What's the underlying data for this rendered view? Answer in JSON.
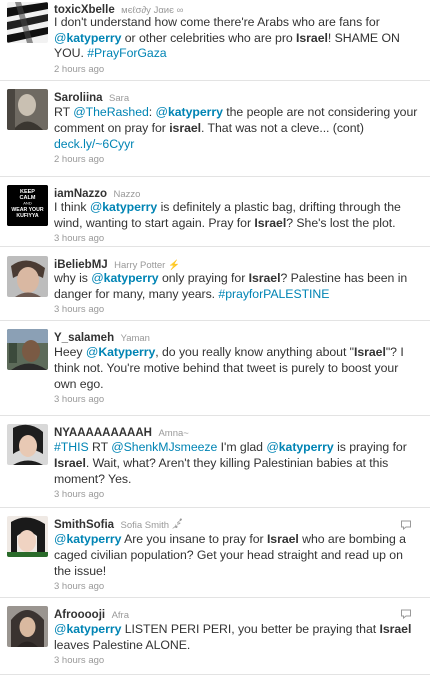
{
  "tweets": [
    {
      "screen_name": "toxicXbelle",
      "full_name": "мєℓσ∂у Jαиє ∞",
      "time": "2 hours ago",
      "segments": [
        {
          "t": "text",
          "v": "I don't understand how come there're Arabs who are fans for "
        },
        {
          "t": "mention",
          "v": "@katyperry"
        },
        {
          "t": "text",
          "v": " or other celebrities who are pro "
        },
        {
          "t": "bold",
          "v": "Israel"
        },
        {
          "t": "text",
          "v": "! SHAME ON YOU. "
        },
        {
          "t": "hashtag",
          "v": "#PrayForGaza"
        }
      ]
    },
    {
      "screen_name": "Saroliina",
      "full_name": "Sara",
      "time": "2 hours ago",
      "segments": [
        {
          "t": "text",
          "v": "RT "
        },
        {
          "t": "mention",
          "v": "@TheRashed"
        },
        {
          "t": "text",
          "v": ": "
        },
        {
          "t": "mention",
          "v": "@katyperry"
        },
        {
          "t": "text",
          "v": " the people are not considering your comment on pray for "
        },
        {
          "t": "bold",
          "v": "israel"
        },
        {
          "t": "text",
          "v": ". That was not a cleve... (cont) "
        },
        {
          "t": "link",
          "v": "deck.ly/~6Cyyr"
        }
      ]
    },
    {
      "screen_name": "iamNazzo",
      "full_name": "Nazzo",
      "time": "3 hours ago",
      "avatar_text": [
        "KEEP",
        "CALM",
        "AND",
        "WEAR YOUR",
        "KUFIYYA"
      ],
      "segments": [
        {
          "t": "text",
          "v": "I think "
        },
        {
          "t": "mention",
          "v": "@katyperry"
        },
        {
          "t": "text",
          "v": " is definitely a plastic bag, drifting through the wind, wanting to start again. Pray for "
        },
        {
          "t": "bold",
          "v": "Israel"
        },
        {
          "t": "text",
          "v": "? She's lost the plot."
        }
      ]
    },
    {
      "screen_name": "iBeliebMJ",
      "full_name": "Harry Potter ⚡",
      "time": "3 hours ago",
      "segments": [
        {
          "t": "text",
          "v": "why is "
        },
        {
          "t": "mention",
          "v": "@katyperry"
        },
        {
          "t": "text",
          "v": " only praying for "
        },
        {
          "t": "bold",
          "v": "Israel"
        },
        {
          "t": "text",
          "v": "? Palestine has been in danger for many, many years. "
        },
        {
          "t": "hashtag",
          "v": "#prayforPALESTINE"
        }
      ]
    },
    {
      "screen_name": "Y_salameh",
      "full_name": "Yaman",
      "time": "3 hours ago",
      "segments": [
        {
          "t": "text",
          "v": "Heey "
        },
        {
          "t": "mention",
          "v": "@Katyperry"
        },
        {
          "t": "text",
          "v": ", do you really know anything about \""
        },
        {
          "t": "bold",
          "v": "Israel"
        },
        {
          "t": "text",
          "v": "\"? I think not. You're motive behind that tweet is purely to boost your own ego."
        }
      ]
    },
    {
      "screen_name": "NYAAAAAAAAAH",
      "full_name": "Amna~",
      "time": "3 hours ago",
      "segments": [
        {
          "t": "hashtag",
          "v": "#THIS"
        },
        {
          "t": "text",
          "v": " RT "
        },
        {
          "t": "mention",
          "v": "@ShenkMJsmeeze"
        },
        {
          "t": "text",
          "v": " I'm glad "
        },
        {
          "t": "mention",
          "v": "@katyperry"
        },
        {
          "t": "text",
          "v": " is praying for "
        },
        {
          "t": "bold",
          "v": "Israel"
        },
        {
          "t": "text",
          "v": ". Wait, what? Aren't they killing Palestinian babies at this moment? Yes."
        }
      ]
    },
    {
      "screen_name": "SmithSofia",
      "full_name": "Sofia Smith ﷴ",
      "time": "3 hours ago",
      "has_reply_icon": true,
      "segments": [
        {
          "t": "mention",
          "v": "@katyperry"
        },
        {
          "t": "text",
          "v": " Are you insane to pray for "
        },
        {
          "t": "bold",
          "v": "Israel"
        },
        {
          "t": "text",
          "v": " who are bombing a caged civilian population? Get your head straight and read up on the issue!"
        }
      ]
    },
    {
      "screen_name": "Afrooooji",
      "full_name": "Afra",
      "time": "3 hours ago",
      "has_reply_icon": true,
      "segments": [
        {
          "t": "mention",
          "v": "@katyperry"
        },
        {
          "t": "text",
          "v": " LISTEN PERI PERI, you better be praying that "
        },
        {
          "t": "bold",
          "v": "Israel"
        },
        {
          "t": "text",
          "v": " leaves Palestine ALONE."
        }
      ]
    }
  ]
}
